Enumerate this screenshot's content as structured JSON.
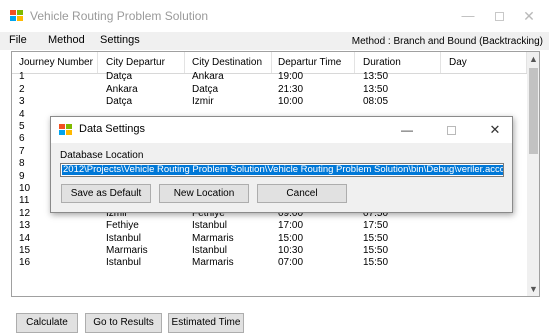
{
  "window": {
    "title": "Vehicle Routing Problem Solution",
    "minimize_glyph": "—",
    "close_glyph": "✕"
  },
  "menu": {
    "items": [
      "File",
      "Method",
      "Settings"
    ],
    "method_status": "Method : Branch and Bound (Backtracking)"
  },
  "table": {
    "columns": [
      "Journey Number",
      "City Departur",
      "City Destination",
      "Departur Time",
      "Duration",
      "Day"
    ],
    "rows": [
      [
        "1",
        "Datça",
        "Ankara",
        "19:00",
        "13:50",
        ""
      ],
      [
        "2",
        "Ankara",
        "Datça",
        "21:30",
        "13:50",
        ""
      ],
      [
        "3",
        "Datça",
        "İzmir",
        "10:00",
        "08:05",
        ""
      ],
      [
        "4",
        "",
        "",
        "",
        "",
        ""
      ],
      [
        "5",
        "",
        "",
        "",
        "",
        ""
      ],
      [
        "6",
        "",
        "",
        "",
        "",
        ""
      ],
      [
        "7",
        "",
        "",
        "",
        "",
        ""
      ],
      [
        "8",
        "",
        "",
        "",
        "",
        ""
      ],
      [
        "9",
        "",
        "",
        "",
        "",
        ""
      ],
      [
        "10",
        "",
        "",
        "",
        "",
        ""
      ],
      [
        "11",
        "İstanbul",
        "İzmir",
        "21:30",
        "11:20",
        ""
      ],
      [
        "12",
        "İzmir",
        "Fethiye",
        "09:00",
        "07:50",
        ""
      ],
      [
        "13",
        "Fethiye",
        "İstanbul",
        "17:00",
        "17:50",
        ""
      ],
      [
        "14",
        "İstanbul",
        "Marmaris",
        "15:00",
        "15:50",
        ""
      ],
      [
        "15",
        "Marmaris",
        "İstanbul",
        "10:30",
        "15:50",
        ""
      ],
      [
        "16",
        "İstanbul",
        "Marmaris",
        "07:00",
        "15:50",
        ""
      ]
    ],
    "scroll_up_glyph": "▲",
    "scroll_down_glyph": "▼"
  },
  "buttons": {
    "calculate": "Calculate",
    "results": "Go to Results",
    "estimated": "Estimated Time"
  },
  "dialog": {
    "title": "Data Settings",
    "minimize_glyph": "—",
    "close_glyph": "✕",
    "db_label": "Database Location",
    "db_value": "2012\\Projects\\Vehicle Routing Problem Solution\\Vehicle Routing Problem Solution\\bin\\Debug\\veriler.accdb",
    "save_default": "Save as Default",
    "new_location": "New Location",
    "cancel": "Cancel"
  },
  "icons": {
    "app": "windows-form-icon",
    "dialog": "windows-form-icon"
  },
  "colors": {
    "selection": "#0078d7",
    "button_face": "#e1e1e1",
    "window_bg": "#f0f0f0",
    "icon_red": "#f25022",
    "icon_green": "#7fba00",
    "icon_blue": "#00a4ef",
    "icon_yellow": "#ffb900"
  }
}
